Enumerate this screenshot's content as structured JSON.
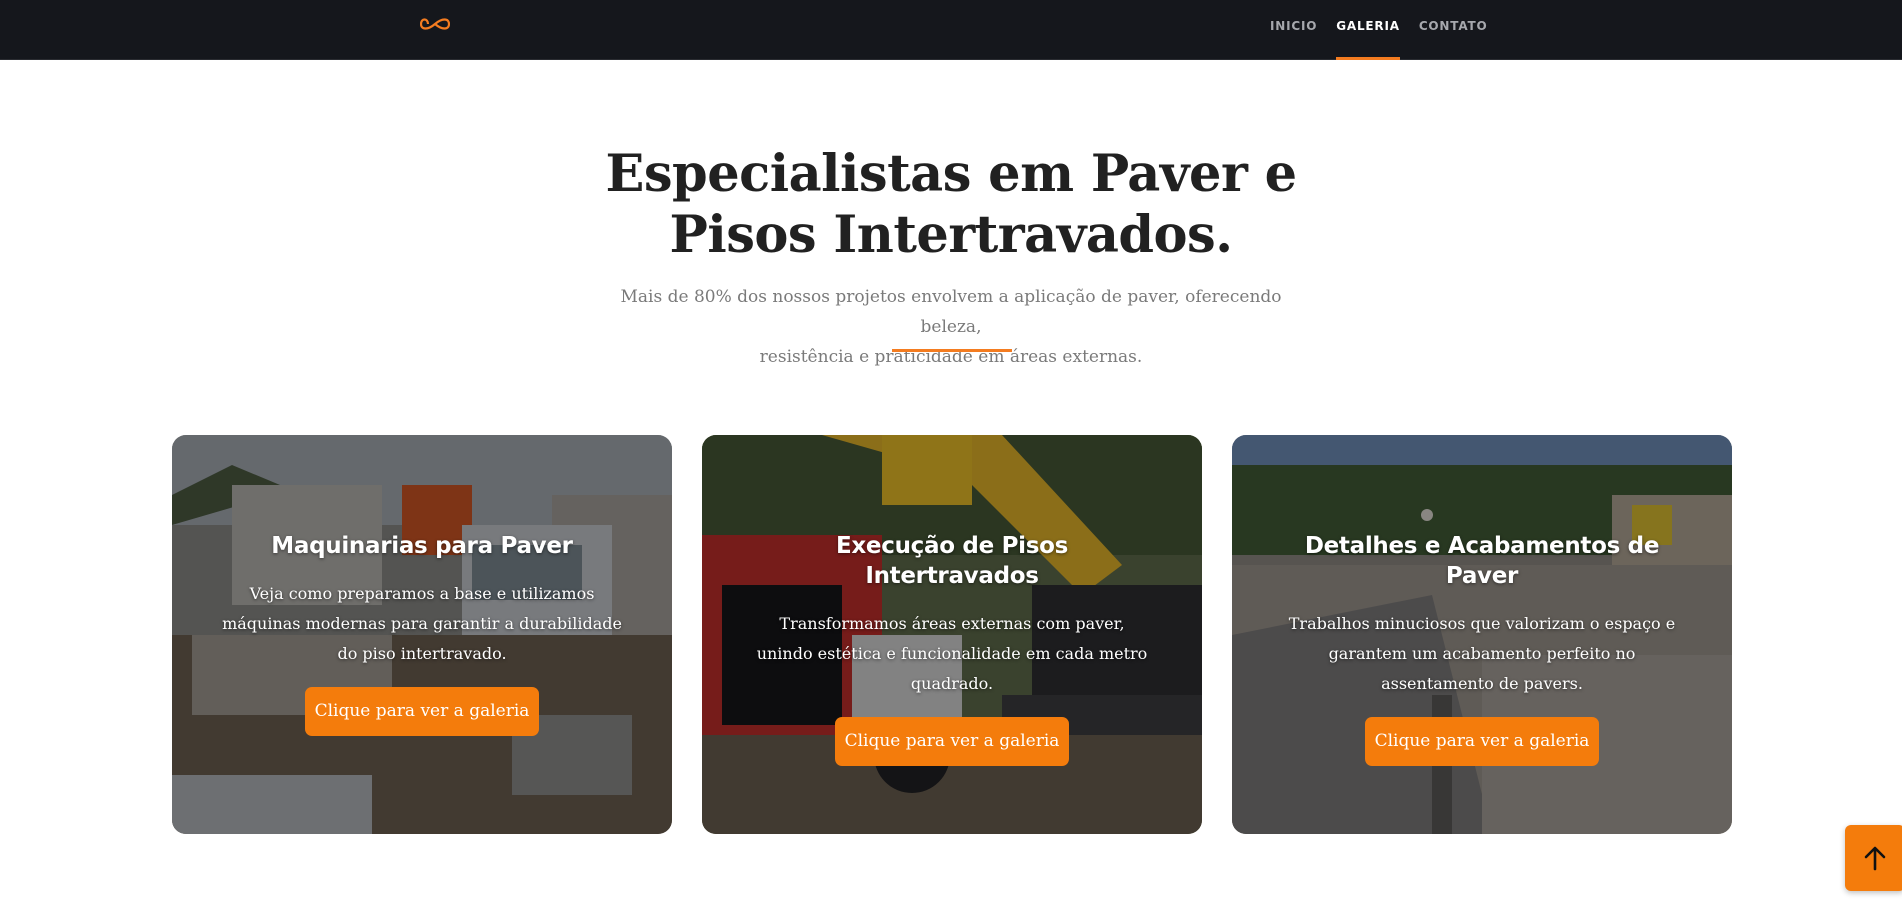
{
  "nav": {
    "logo_icon": "infinity-logo-icon",
    "links": [
      {
        "label": "INICIO",
        "active": false
      },
      {
        "label": "GALERIA",
        "active": true
      },
      {
        "label": "CONTATO",
        "active": false
      }
    ]
  },
  "hero": {
    "title_line1": "Especialistas em Paver e",
    "title_line2": "Pisos Intertravados.",
    "subtitle_line1": "Mais de 80% dos nossos projetos envolvem a aplicação de paver, oferecendo beleza,",
    "subtitle_line2": "resistência e praticidade em áreas externas."
  },
  "cards": [
    {
      "title": "Maquinarias para Paver",
      "text": "Veja como preparamos a base e utilizamos máquinas modernas para garantir a durabilidade do piso intertravado.",
      "button": "Clique para ver a galeria"
    },
    {
      "title": "Execução de Pisos Intertravados",
      "text": "Transformamos áreas externas com paver, unindo estética e funcionalidade em cada metro quadrado.",
      "button": "Clique para ver a galeria"
    },
    {
      "title": "Detalhes e Acabamentos de Paver",
      "text": "Trabalhos minuciosos que valorizam o espaço e garantem um acabamento perfeito no assentamento de pavers.",
      "button": "Clique para ver a galeria"
    }
  ],
  "back_to_top_icon": "arrow-up-icon",
  "colors": {
    "accent": "#f47c0c",
    "nav_bg": "#15171c"
  }
}
